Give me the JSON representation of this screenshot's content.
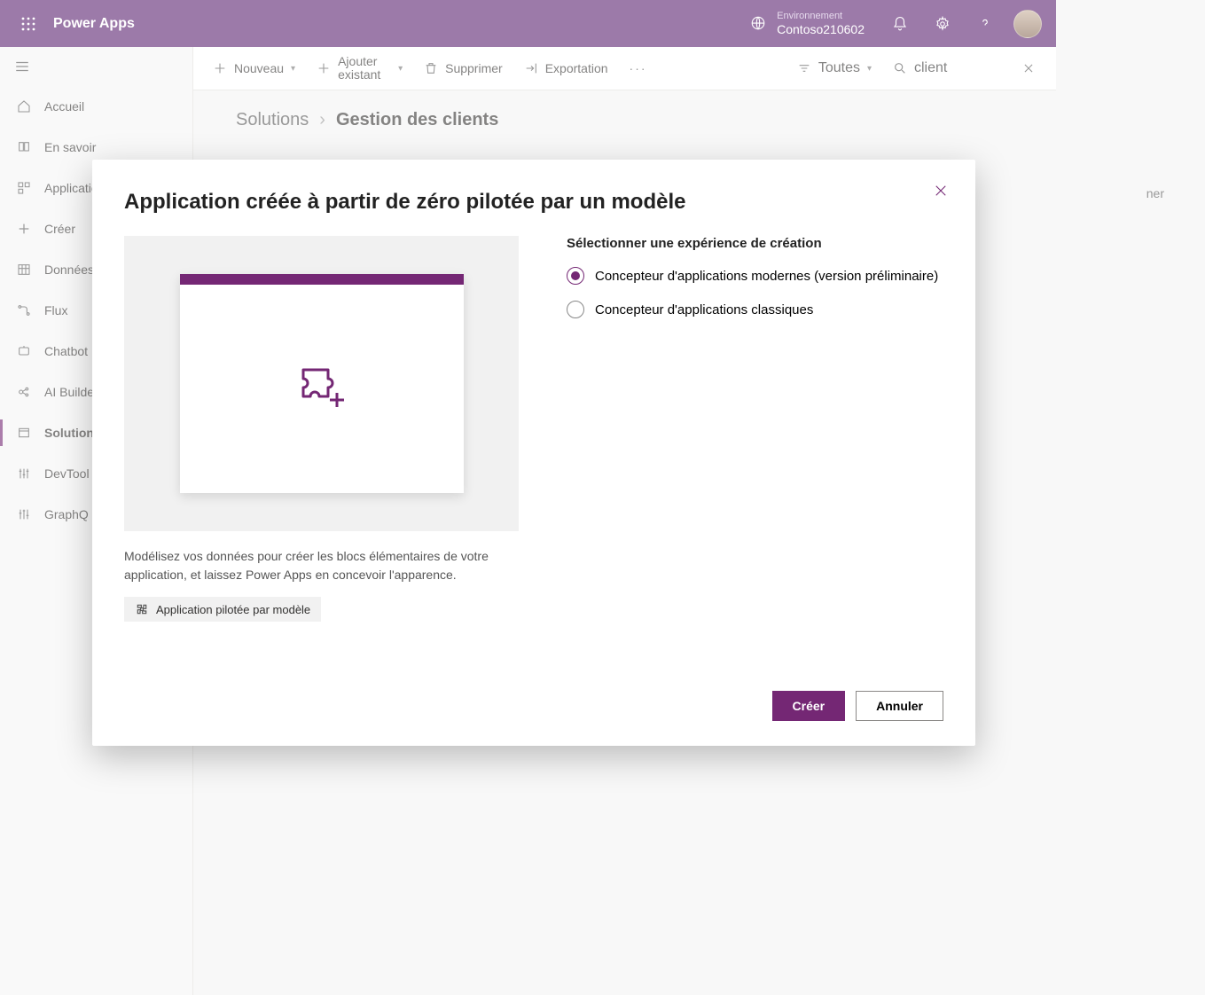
{
  "app_title": "Power Apps",
  "environment": {
    "label": "Environnement",
    "name": "Contoso210602"
  },
  "nav": [
    {
      "label": "Accueil"
    },
    {
      "label": "En savoir"
    },
    {
      "label": "Application"
    },
    {
      "label": "Créer"
    },
    {
      "label": "Données"
    },
    {
      "label": "Flux"
    },
    {
      "label": "Chatbot"
    },
    {
      "label": "AI Builder"
    },
    {
      "label": "Solutions"
    },
    {
      "label": "DevTool"
    },
    {
      "label": "GraphQ"
    }
  ],
  "commands": {
    "new": "Nouveau",
    "add_existing": "Ajouter existant",
    "delete": "Supprimer",
    "export": "Exportation",
    "filter_all": "Toutes",
    "search_value": "client"
  },
  "breadcrumb": {
    "root": "Solutions",
    "current": "Gestion des clients"
  },
  "stray_text": "ner",
  "modal": {
    "title": "Application créée à partir de zéro pilotée par un modèle",
    "description": "Modélisez vos données pour créer les blocs élémentaires de votre application, et laissez Power Apps en concevoir l'apparence.",
    "tag": "Application pilotée par modèle",
    "options_title": "Sélectionner une expérience de création",
    "option_modern": "Concepteur d'applications modernes (version préliminaire)",
    "option_classic": "Concepteur d'applications classiques",
    "create": "Créer",
    "cancel": "Annuler"
  }
}
